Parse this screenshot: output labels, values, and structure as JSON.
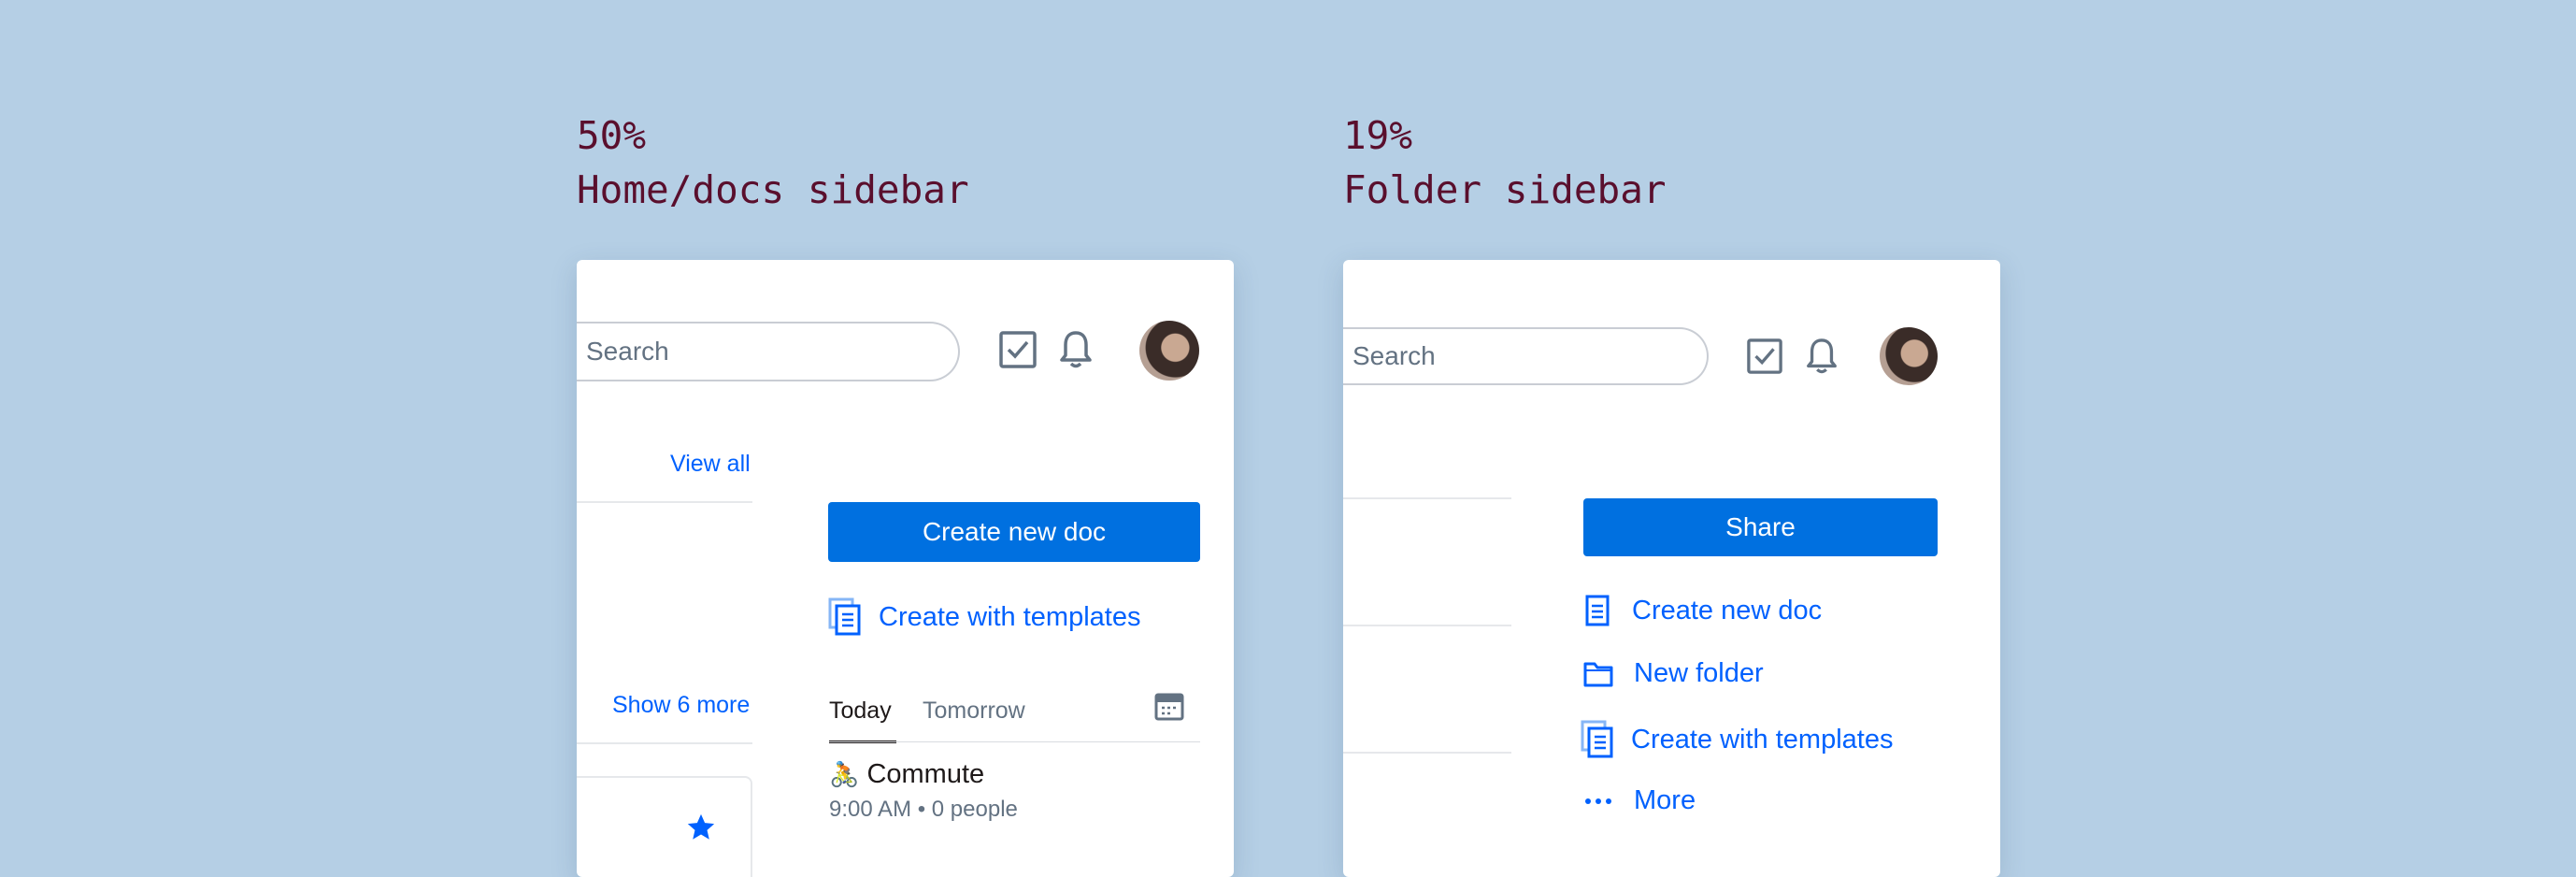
{
  "captions": [
    {
      "percent": "50%",
      "label": "Home/docs sidebar"
    },
    {
      "percent": "19%",
      "label": "Folder sidebar"
    }
  ],
  "home_panel": {
    "search_placeholder": "Search",
    "view_all": "View all",
    "show_more": "Show 6 more",
    "create_doc_button": "Create new doc",
    "create_templates": "Create with templates",
    "tabs": [
      "Today",
      "Tomorrow"
    ],
    "active_tab": "Today",
    "event": {
      "emoji": "🚴",
      "title": "Commute",
      "details": "9:00 AM • 0 people"
    }
  },
  "folder_panel": {
    "search_placeholder": "Search",
    "share_button": "Share",
    "actions": [
      {
        "label": "Create new doc",
        "icon": "doc-icon"
      },
      {
        "label": "New folder",
        "icon": "folder-icon"
      },
      {
        "label": "Create with templates",
        "icon": "templates-icon"
      },
      {
        "label": "More",
        "icon": "more-icon"
      }
    ]
  },
  "colors": {
    "background": "#b5cfe5",
    "caption": "#5a0f2d",
    "accent": "#0070e0",
    "link": "#0061fe",
    "icon_gray": "#637282"
  }
}
